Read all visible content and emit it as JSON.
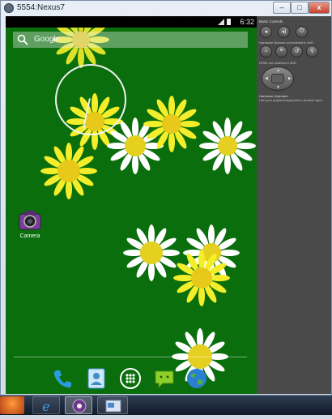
{
  "window": {
    "title": "5554:Nexus7",
    "minimize_label": "–",
    "maximize_label": "□",
    "close_label": "x"
  },
  "status_bar": {
    "time": "6:32"
  },
  "search": {
    "label": "Google"
  },
  "home": {
    "apps": [
      {
        "label": "Camera",
        "icon": "camera-icon"
      }
    ]
  },
  "dock": [
    {
      "icon": "phone-icon"
    },
    {
      "icon": "contacts-icon"
    },
    {
      "icon": "app-drawer-icon"
    },
    {
      "icon": "messaging-icon"
    },
    {
      "icon": "browser-icon"
    }
  ],
  "controls": {
    "title": "Basic Controls",
    "buttons_note": "Hardware Buttons not enabled in AVD",
    "dpad_note": "DPAD not enabled in AVD",
    "keyboard_title": "Hardware Keyboard",
    "keyboard_note": "Use your physical keyboard to provide input",
    "row1": [
      "volume-down-icon",
      "volume-up-icon",
      "power-icon"
    ],
    "row2": [
      "home-icon",
      "menu-icon",
      "back-icon",
      "search-icon"
    ]
  },
  "taskbar": {
    "items": [
      "start-button",
      "internet-explorer-icon",
      "emulator-icon",
      "window-icon"
    ]
  },
  "colors": {
    "wallpaper": "#0a6e0c",
    "status_bar": "#000000",
    "controls_panel": "#4a4a4a"
  }
}
